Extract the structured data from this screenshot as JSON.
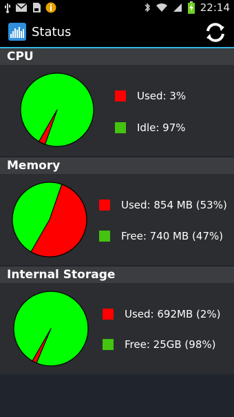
{
  "status_bar": {
    "time": "22:14",
    "battery_level": "46"
  },
  "app": {
    "title": "Status",
    "colors": {
      "used": "#ff0000",
      "free": "#00ff00",
      "accent": "#33b5e5"
    }
  },
  "sections": [
    {
      "title": "CPU",
      "used_fraction": 0.03,
      "used_label": "Used: 3%",
      "free_label": "Idle: 97%"
    },
    {
      "title": "Memory",
      "used_fraction": 0.53,
      "used_label": "Used: 854 MB (53%)",
      "free_label": "Free: 740 MB (47%)"
    },
    {
      "title": "Internal Storage",
      "used_fraction": 0.02,
      "used_label": "Used: 692MB (2%)",
      "free_label": "Free: 25GB (98%)"
    }
  ]
}
